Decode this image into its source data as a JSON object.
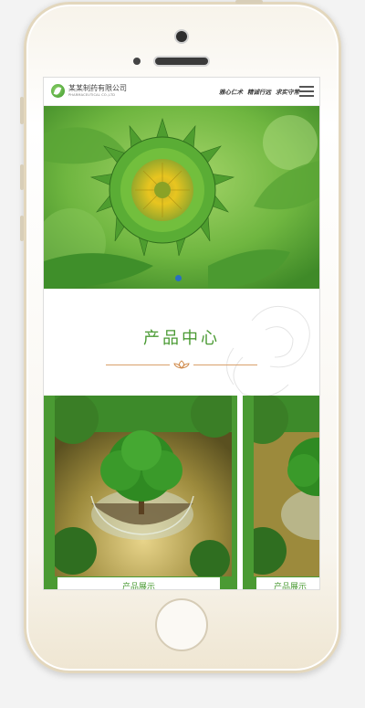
{
  "header": {
    "company_name": "某某制药有限公司",
    "company_sub": "PHARMACEUTICAL CO.,LTD",
    "slogans": [
      "雅心仁术",
      "精诚行远",
      "求实守常"
    ],
    "logo_icon": "leaf-logo-icon",
    "menu_icon": "hamburger-menu-icon"
  },
  "banner": {
    "image": "sunflower-bud",
    "active_slide_dot_color": "#2a6fbf"
  },
  "products_section": {
    "title": "产品中心",
    "accent_color": "#4a9a33",
    "divider_color": "#d9a06b",
    "cards": [
      {
        "image": "tree-in-broken-glass-sphere",
        "caption": "产品展示"
      },
      {
        "image": "tree-in-broken-glass-sphere",
        "caption": "产品展示"
      }
    ]
  }
}
